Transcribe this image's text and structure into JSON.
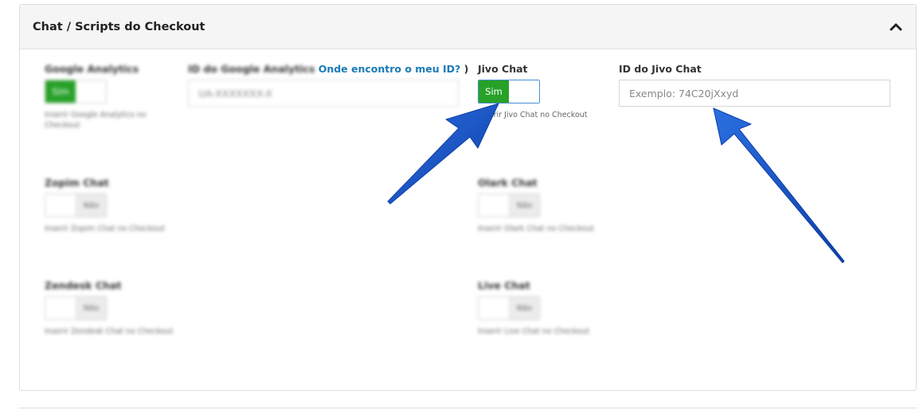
{
  "panel": {
    "title": "Chat / Scripts do Checkout",
    "collapse_icon": "chevron-up-icon"
  },
  "fields": {
    "google_analytics": {
      "label": "Google Analytics",
      "toggle_on": "Sim",
      "help": "Inserir Google Analytics no Checkout"
    },
    "analytics_id": {
      "label_prefix": "ID do Google Analytics",
      "label_link": "Onde encontro o meu ID?",
      "label_suffix": " )",
      "placeholder": "UA-XXXXXXX-X"
    },
    "jivo_chat": {
      "label": "Jivo Chat",
      "toggle_on": "Sim",
      "help": "Inserir Jivo Chat no Checkout"
    },
    "jivo_id": {
      "label": "ID do Jivo Chat",
      "placeholder": "Exemplo: 74C20jXxyd"
    },
    "zopim_chat": {
      "label": "Zopim Chat",
      "toggle_off": "Não",
      "help": "Inserir Zopim Chat no Checkout"
    },
    "olark_chat": {
      "label": "Olark Chat",
      "toggle_off": "Não",
      "help": "Inserir Olark Chat no Checkout"
    },
    "zendesk_chat": {
      "label": "Zendesk Chat",
      "toggle_off": "Não",
      "help": "Inserir Zendesk Chat no Checkout"
    },
    "live_chat": {
      "label": "Live Chat",
      "toggle_off": "Não",
      "help": "Inserir Live Chat no Checkout"
    }
  },
  "colors": {
    "toggle_on": "#27a127",
    "arrow": "#1a56c4",
    "link": "#1a7ab5"
  }
}
